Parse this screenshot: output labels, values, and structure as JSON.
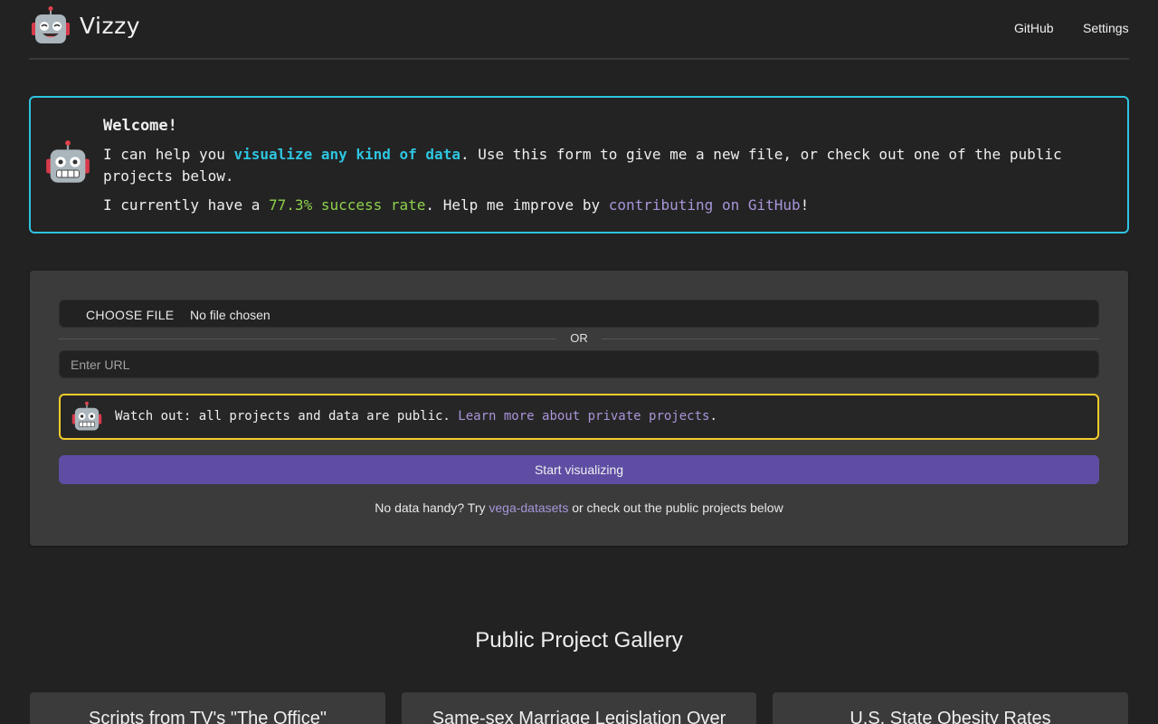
{
  "header": {
    "logo_text": "Vizzy",
    "nav": [
      "GitHub",
      "Settings"
    ]
  },
  "welcome": {
    "title": "Welcome!",
    "line1_pre": "I can help you ",
    "line1_highlight": "visualize any kind of data",
    "line1_post": ". Use this form to give me a new file, or check out one of the public projects below.",
    "line2_pre": "I currently have a ",
    "line2_rate": "77.3% success rate",
    "line2_mid": ". Help me improve by ",
    "line2_link": "contributing on GitHub",
    "line2_post": "!"
  },
  "form": {
    "file_button": "CHOOSE FILE",
    "file_status": "No file chosen",
    "or_label": "OR",
    "url_placeholder": "Enter URL",
    "warning_pre": "Watch out: all projects and data are public. ",
    "warning_link": "Learn more about private projects",
    "warning_post": ".",
    "start_button": "Start visualizing",
    "hint_pre": "No data handy? Try ",
    "hint_link": "vega-datasets",
    "hint_post": " or check out the public projects below"
  },
  "gallery": {
    "title": "Public Project Gallery",
    "projects": [
      "Scripts from TV's \"The Office\"",
      "Same-sex Marriage Legislation Over",
      "U.S. State Obesity Rates"
    ]
  },
  "colors": {
    "accent_cyan": "#2ec4e0",
    "success_green": "#8ed14b",
    "link_purple": "#a995d9",
    "warning_yellow": "#f5cd2a",
    "button_purple": "#5f4da4"
  },
  "icons": [
    "robot-icon"
  ]
}
